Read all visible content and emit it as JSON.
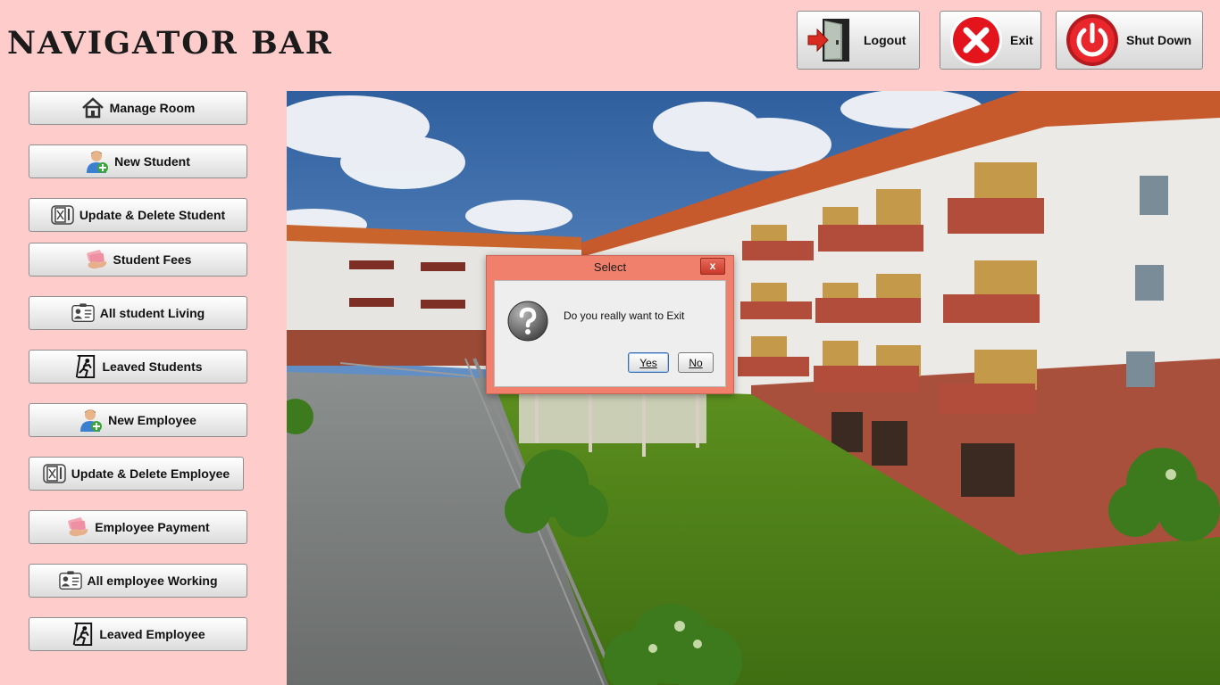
{
  "header": {
    "title": "NAVIGATOR BAR",
    "buttons": [
      {
        "label": "Logout",
        "icon": "logout-door-icon"
      },
      {
        "label": "Exit",
        "icon": "red-x-icon"
      },
      {
        "label": "Shut Down",
        "icon": "power-icon"
      }
    ]
  },
  "sidebar": {
    "items": [
      {
        "label": "Manage Room",
        "icon": "home-icon"
      },
      {
        "label": "New Student",
        "icon": "add-user-icon"
      },
      {
        "label": "Update & Delete Student",
        "icon": "edit-document-icon"
      },
      {
        "label": "Student Fees",
        "icon": "money-hand-icon"
      },
      {
        "label": "All student Living",
        "icon": "id-card-icon"
      },
      {
        "label": "Leaved Students",
        "icon": "exit-runner-icon"
      },
      {
        "label": "New Employee",
        "icon": "add-user-icon"
      },
      {
        "label": "Update & Delete Employee",
        "icon": "edit-document-icon"
      },
      {
        "label": "Employee Payment",
        "icon": "money-hand-icon"
      },
      {
        "label": "All employee Working",
        "icon": "id-card-icon"
      },
      {
        "label": "Leaved Employee",
        "icon": "exit-runner-icon"
      }
    ]
  },
  "dialog": {
    "title": "Select",
    "close": "x",
    "message": "Do you really want to Exit",
    "yes": "Yes",
    "no": "No"
  },
  "colors": {
    "background": "#ffcccc",
    "dialog_frame": "#f0806c"
  }
}
